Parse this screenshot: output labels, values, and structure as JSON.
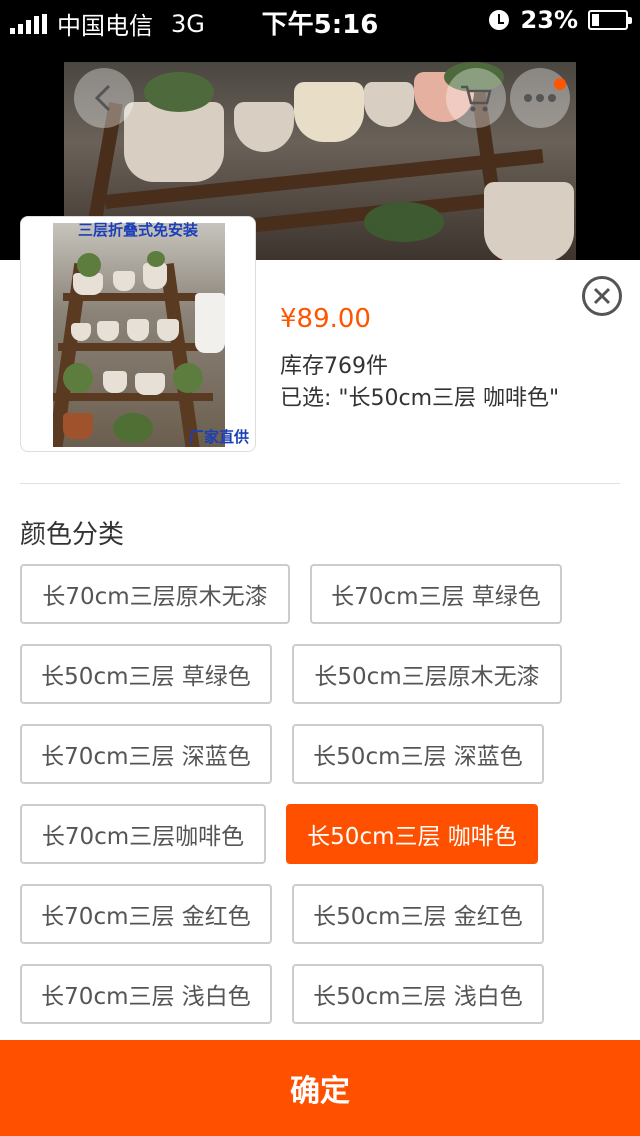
{
  "status_bar": {
    "carrier": "中国电信",
    "network": "3G",
    "time": "下午5:16",
    "battery": "23%"
  },
  "header": {
    "back_icon": "chevron-left-icon",
    "cart_icon": "cart-icon",
    "more_icon": "more-dots-icon"
  },
  "product": {
    "thumb_top_text": "三层折叠式免安装",
    "thumb_bottom_text": "厂家直供",
    "price": "¥89.00",
    "stock": "库存769件",
    "selected": "已选: \"长50cm三层 咖啡色\""
  },
  "sku": {
    "section_title": "颜色分类",
    "options": [
      {
        "label": "长70cm三层原木无漆",
        "active": false
      },
      {
        "label": "长70cm三层 草绿色",
        "active": false
      },
      {
        "label": "长50cm三层 草绿色",
        "active": false
      },
      {
        "label": "长50cm三层原木无漆",
        "active": false
      },
      {
        "label": "长70cm三层 深蓝色",
        "active": false
      },
      {
        "label": "长50cm三层 深蓝色",
        "active": false
      },
      {
        "label": "长70cm三层咖啡色",
        "active": false
      },
      {
        "label": "长50cm三层 咖啡色",
        "active": true
      },
      {
        "label": "长70cm三层 金红色",
        "active": false
      },
      {
        "label": "长50cm三层 金红色",
        "active": false
      },
      {
        "label": "长70cm三层 浅白色",
        "active": false
      },
      {
        "label": "长50cm三层 浅白色",
        "active": false
      }
    ]
  },
  "confirm_label": "确定",
  "colors": {
    "accent": "#ff5000",
    "price": "#ff5500"
  }
}
